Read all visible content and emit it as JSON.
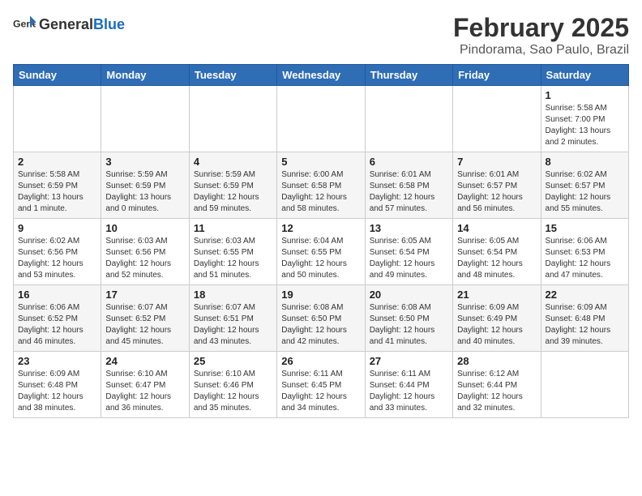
{
  "header": {
    "logo_general": "General",
    "logo_blue": "Blue",
    "month": "February 2025",
    "location": "Pindorama, Sao Paulo, Brazil"
  },
  "days_of_week": [
    "Sunday",
    "Monday",
    "Tuesday",
    "Wednesday",
    "Thursday",
    "Friday",
    "Saturday"
  ],
  "weeks": [
    [
      {
        "day": "",
        "info": ""
      },
      {
        "day": "",
        "info": ""
      },
      {
        "day": "",
        "info": ""
      },
      {
        "day": "",
        "info": ""
      },
      {
        "day": "",
        "info": ""
      },
      {
        "day": "",
        "info": ""
      },
      {
        "day": "1",
        "info": "Sunrise: 5:58 AM\nSunset: 7:00 PM\nDaylight: 13 hours\nand 2 minutes."
      }
    ],
    [
      {
        "day": "2",
        "info": "Sunrise: 5:58 AM\nSunset: 6:59 PM\nDaylight: 13 hours\nand 1 minute."
      },
      {
        "day": "3",
        "info": "Sunrise: 5:59 AM\nSunset: 6:59 PM\nDaylight: 13 hours\nand 0 minutes."
      },
      {
        "day": "4",
        "info": "Sunrise: 5:59 AM\nSunset: 6:59 PM\nDaylight: 12 hours\nand 59 minutes."
      },
      {
        "day": "5",
        "info": "Sunrise: 6:00 AM\nSunset: 6:58 PM\nDaylight: 12 hours\nand 58 minutes."
      },
      {
        "day": "6",
        "info": "Sunrise: 6:01 AM\nSunset: 6:58 PM\nDaylight: 12 hours\nand 57 minutes."
      },
      {
        "day": "7",
        "info": "Sunrise: 6:01 AM\nSunset: 6:57 PM\nDaylight: 12 hours\nand 56 minutes."
      },
      {
        "day": "8",
        "info": "Sunrise: 6:02 AM\nSunset: 6:57 PM\nDaylight: 12 hours\nand 55 minutes."
      }
    ],
    [
      {
        "day": "9",
        "info": "Sunrise: 6:02 AM\nSunset: 6:56 PM\nDaylight: 12 hours\nand 53 minutes."
      },
      {
        "day": "10",
        "info": "Sunrise: 6:03 AM\nSunset: 6:56 PM\nDaylight: 12 hours\nand 52 minutes."
      },
      {
        "day": "11",
        "info": "Sunrise: 6:03 AM\nSunset: 6:55 PM\nDaylight: 12 hours\nand 51 minutes."
      },
      {
        "day": "12",
        "info": "Sunrise: 6:04 AM\nSunset: 6:55 PM\nDaylight: 12 hours\nand 50 minutes."
      },
      {
        "day": "13",
        "info": "Sunrise: 6:05 AM\nSunset: 6:54 PM\nDaylight: 12 hours\nand 49 minutes."
      },
      {
        "day": "14",
        "info": "Sunrise: 6:05 AM\nSunset: 6:54 PM\nDaylight: 12 hours\nand 48 minutes."
      },
      {
        "day": "15",
        "info": "Sunrise: 6:06 AM\nSunset: 6:53 PM\nDaylight: 12 hours\nand 47 minutes."
      }
    ],
    [
      {
        "day": "16",
        "info": "Sunrise: 6:06 AM\nSunset: 6:52 PM\nDaylight: 12 hours\nand 46 minutes."
      },
      {
        "day": "17",
        "info": "Sunrise: 6:07 AM\nSunset: 6:52 PM\nDaylight: 12 hours\nand 45 minutes."
      },
      {
        "day": "18",
        "info": "Sunrise: 6:07 AM\nSunset: 6:51 PM\nDaylight: 12 hours\nand 43 minutes."
      },
      {
        "day": "19",
        "info": "Sunrise: 6:08 AM\nSunset: 6:50 PM\nDaylight: 12 hours\nand 42 minutes."
      },
      {
        "day": "20",
        "info": "Sunrise: 6:08 AM\nSunset: 6:50 PM\nDaylight: 12 hours\nand 41 minutes."
      },
      {
        "day": "21",
        "info": "Sunrise: 6:09 AM\nSunset: 6:49 PM\nDaylight: 12 hours\nand 40 minutes."
      },
      {
        "day": "22",
        "info": "Sunrise: 6:09 AM\nSunset: 6:48 PM\nDaylight: 12 hours\nand 39 minutes."
      }
    ],
    [
      {
        "day": "23",
        "info": "Sunrise: 6:09 AM\nSunset: 6:48 PM\nDaylight: 12 hours\nand 38 minutes."
      },
      {
        "day": "24",
        "info": "Sunrise: 6:10 AM\nSunset: 6:47 PM\nDaylight: 12 hours\nand 36 minutes."
      },
      {
        "day": "25",
        "info": "Sunrise: 6:10 AM\nSunset: 6:46 PM\nDaylight: 12 hours\nand 35 minutes."
      },
      {
        "day": "26",
        "info": "Sunrise: 6:11 AM\nSunset: 6:45 PM\nDaylight: 12 hours\nand 34 minutes."
      },
      {
        "day": "27",
        "info": "Sunrise: 6:11 AM\nSunset: 6:44 PM\nDaylight: 12 hours\nand 33 minutes."
      },
      {
        "day": "28",
        "info": "Sunrise: 6:12 AM\nSunset: 6:44 PM\nDaylight: 12 hours\nand 32 minutes."
      },
      {
        "day": "",
        "info": ""
      }
    ]
  ]
}
